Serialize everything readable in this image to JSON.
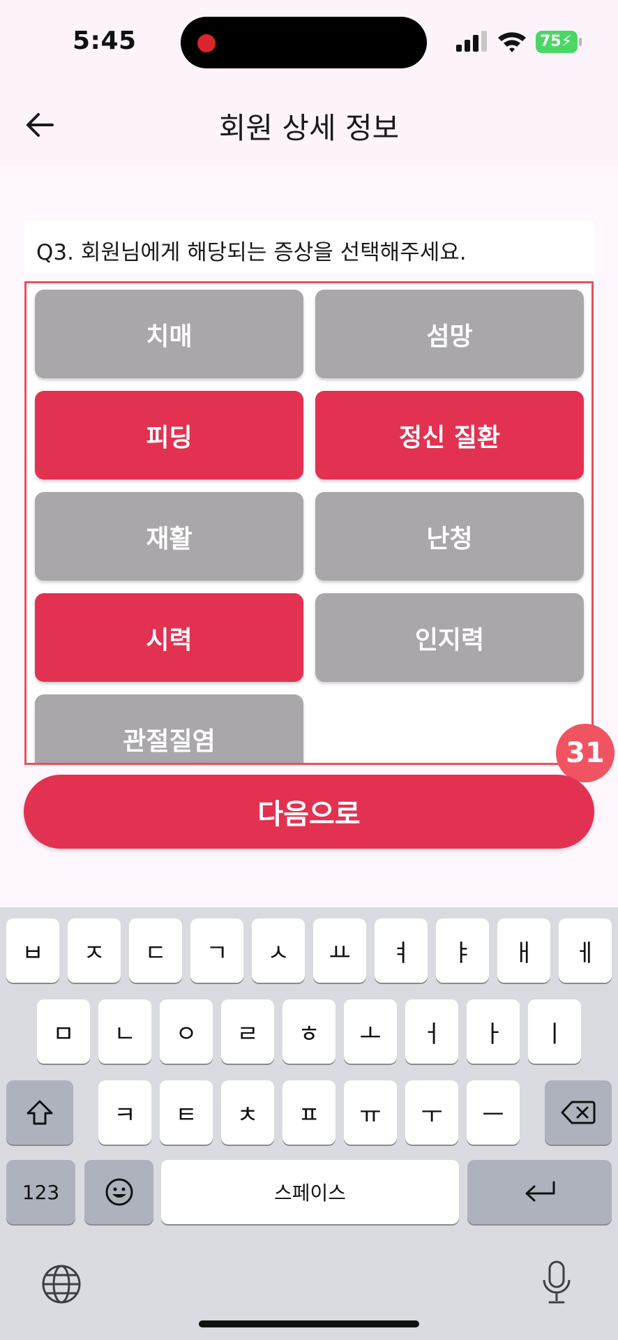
{
  "status_bar": {
    "time": "5:45",
    "battery": "75"
  },
  "header": {
    "title": "회원 상세 정보",
    "back_icon": "arrow-left-icon"
  },
  "question": {
    "text": "Q3. 회원님에게 해당되는 증상을 선택해주세요."
  },
  "options": [
    {
      "label": "치매",
      "selected": false
    },
    {
      "label": "섬망",
      "selected": false
    },
    {
      "label": "피딩",
      "selected": true
    },
    {
      "label": "정신 질환",
      "selected": true
    },
    {
      "label": "재활",
      "selected": false
    },
    {
      "label": "난청",
      "selected": false
    },
    {
      "label": "시력",
      "selected": true
    },
    {
      "label": "인지력",
      "selected": false
    },
    {
      "label": "관절질염",
      "selected": false
    }
  ],
  "badge": "31",
  "next_button": {
    "label": "다음으로"
  },
  "colors": {
    "accent": "#e33151",
    "unselected": "#a9a7aa",
    "frame": "#e8505b"
  },
  "keyboard": {
    "row1": [
      "ㅂ",
      "ㅈ",
      "ㄷ",
      "ㄱ",
      "ㅅ",
      "ㅛ",
      "ㅕ",
      "ㅑ",
      "ㅐ",
      "ㅔ"
    ],
    "row2": [
      "ㅁ",
      "ㄴ",
      "ㅇ",
      "ㄹ",
      "ㅎ",
      "ㅗ",
      "ㅓ",
      "ㅏ",
      "ㅣ"
    ],
    "row3": [
      "ㅋ",
      "ㅌ",
      "ㅊ",
      "ㅍ",
      "ㅠ",
      "ㅜ",
      "ㅡ"
    ],
    "numbers": "123",
    "space": "스페이스"
  }
}
